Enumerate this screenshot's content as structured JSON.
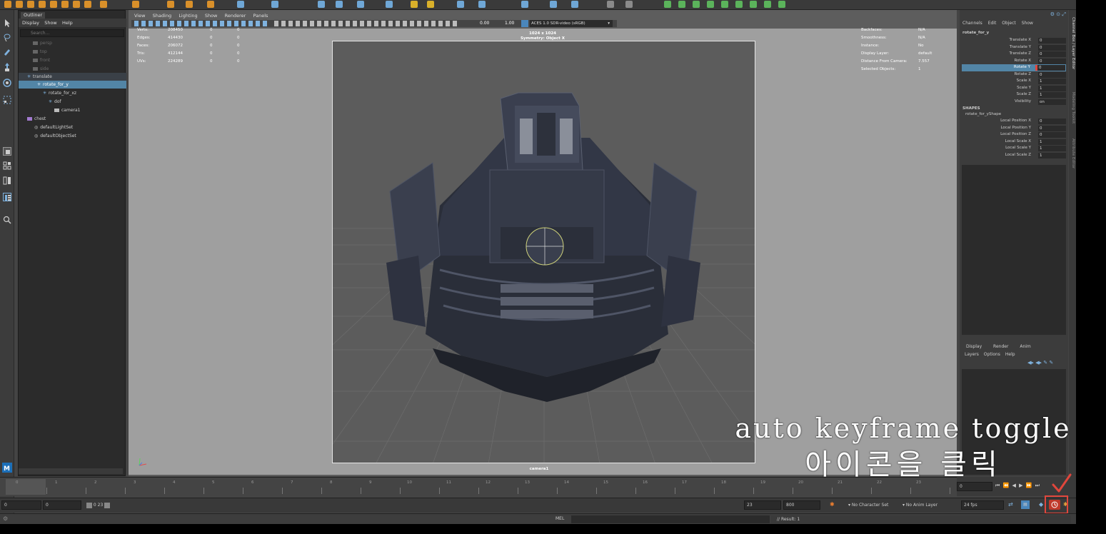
{
  "colors": {
    "selection": "#5285a6",
    "panel": "#3c3c3c",
    "viewport_bg": "#9f9f9f",
    "gate_bg": "#5c5c5c",
    "accent_red": "#e0463c",
    "model": "#2f3340"
  },
  "outliner": {
    "tab_label": "Outliner",
    "menu": [
      "Display",
      "Show",
      "Help"
    ],
    "search_placeholder": "Search...",
    "items": [
      {
        "label": "persp",
        "icon": "camera-icon",
        "dim": true
      },
      {
        "label": "top",
        "icon": "camera-icon",
        "dim": true
      },
      {
        "label": "front",
        "icon": "camera-icon",
        "dim": true
      },
      {
        "label": "side",
        "icon": "camera-icon",
        "dim": true
      },
      {
        "label": "translate",
        "icon": "transform-icon"
      },
      {
        "label": "rotate_for_y",
        "icon": "transform-icon",
        "selected": true
      },
      {
        "label": "rotate_for_xz",
        "icon": "transform-icon"
      },
      {
        "label": "dof",
        "icon": "transform-icon"
      },
      {
        "label": "camera1",
        "icon": "camera-icon"
      },
      {
        "label": "chest",
        "icon": "mesh-icon"
      },
      {
        "label": "defaultLightSet",
        "icon": "set-icon"
      },
      {
        "label": "defaultObjectSet",
        "icon": "set-icon"
      }
    ]
  },
  "viewport": {
    "menu": [
      "View",
      "Shading",
      "Lighting",
      "Show",
      "Renderer",
      "Panels"
    ],
    "exposure": "0.00",
    "gamma": "1.00",
    "color_space": "ACES 1.0 SDR-video (sRGB)",
    "resolution": "1024 x 1024",
    "symmetry": "Symmetry: Object X",
    "camera_label": "camera1",
    "stats_left": [
      {
        "name": "Verts:",
        "v1": "208450",
        "v2": "0",
        "v3": "0"
      },
      {
        "name": "Edges:",
        "v1": "414430",
        "v2": "0",
        "v3": "0"
      },
      {
        "name": "Faces:",
        "v1": "206072",
        "v2": "0",
        "v3": "0"
      },
      {
        "name": "Tris:",
        "v1": "412144",
        "v2": "0",
        "v3": "0"
      },
      {
        "name": "UVs:",
        "v1": "224289",
        "v2": "0",
        "v3": "0"
      }
    ],
    "stats_right": [
      {
        "name": "Backfaces:",
        "value": "N/A"
      },
      {
        "name": "Smoothness:",
        "value": "N/A"
      },
      {
        "name": "Instance:",
        "value": "No"
      },
      {
        "name": "Display Layer:",
        "value": "default"
      },
      {
        "name": "Distance From Camera:",
        "value": "7.557"
      },
      {
        "name": "Selected Objects:",
        "value": "1"
      }
    ]
  },
  "channelbox": {
    "menu": [
      "Channels",
      "Edit",
      "Object",
      "Show"
    ],
    "object_name": "rotate_for_y",
    "attributes": [
      {
        "name": "Translate X",
        "value": "0"
      },
      {
        "name": "Translate Y",
        "value": "0"
      },
      {
        "name": "Translate Z",
        "value": "0"
      },
      {
        "name": "Rotate X",
        "value": "0"
      },
      {
        "name": "Rotate Y",
        "value": "0",
        "selected": true
      },
      {
        "name": "Rotate Z",
        "value": "0"
      },
      {
        "name": "Scale X",
        "value": "1"
      },
      {
        "name": "Scale Y",
        "value": "1"
      },
      {
        "name": "Scale Z",
        "value": "1"
      },
      {
        "name": "Visibility",
        "value": "on"
      }
    ],
    "shapes_header": "SHAPES",
    "shape_name": "rotate_for_yShape",
    "shape_attributes": [
      {
        "name": "Local Position X",
        "value": "0"
      },
      {
        "name": "Local Position Y",
        "value": "0"
      },
      {
        "name": "Local Position Z",
        "value": "0"
      },
      {
        "name": "Local Scale X",
        "value": "1"
      },
      {
        "name": "Local Scale Y",
        "value": "1"
      },
      {
        "name": "Local Scale Z",
        "value": "1"
      }
    ],
    "layer_tabs": [
      "Display",
      "Render",
      "Anim"
    ],
    "layer_menu": [
      "Layers",
      "Options",
      "Help"
    ]
  },
  "side_tabs": [
    "Channel Box / Layer Editor",
    "Modeling Toolkit",
    "Attribute Editor"
  ],
  "timeline": {
    "ticks": [
      "0",
      "1",
      "2",
      "3",
      "4",
      "5",
      "6",
      "7",
      "8",
      "9",
      "10",
      "11",
      "12",
      "13",
      "14",
      "15",
      "16",
      "17",
      "18",
      "19",
      "20",
      "21",
      "22",
      "23"
    ],
    "current_frame": "0"
  },
  "rangebar": {
    "start": "0",
    "inner_start": "0",
    "range_label": "0  23",
    "inner_end": "23",
    "end": "800",
    "character_set": "No Character Set",
    "anim_layer": "No Anim Layer",
    "fps": "24 fps"
  },
  "cmdline": {
    "lang": "MEL",
    "result": "// Result: 1"
  },
  "caption": {
    "line1": "auto keyframe toggle",
    "line2": "아이콘을 클릭"
  }
}
